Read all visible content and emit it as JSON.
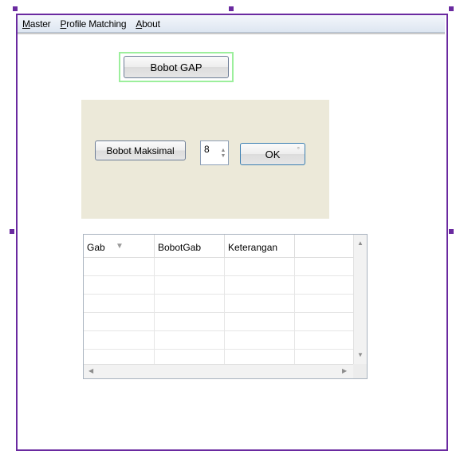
{
  "menu": {
    "items": [
      {
        "mnemonic": "M",
        "rest": "aster"
      },
      {
        "mnemonic": "P",
        "rest": "rofile Matching"
      },
      {
        "mnemonic": "A",
        "rest": "bout"
      }
    ]
  },
  "buttons": {
    "bobot_gap": "Bobot GAP",
    "bobot_maksimal": "Bobot Maksimal",
    "ok": "OK"
  },
  "spinner": {
    "value": "8"
  },
  "grid": {
    "columns": [
      "Gab",
      "BobotGab",
      "Keterangan",
      ""
    ],
    "rows": [
      [
        "",
        "",
        "",
        ""
      ],
      [
        "",
        "",
        "",
        ""
      ],
      [
        "",
        "",
        "",
        ""
      ],
      [
        "",
        "",
        "",
        ""
      ],
      [
        "",
        "",
        "",
        ""
      ],
      [
        "",
        "",
        "",
        ""
      ]
    ]
  },
  "icons": {
    "sort": "sort-down-icon",
    "scroll_up": "scroll-up-icon",
    "scroll_down": "scroll-down-icon",
    "scroll_left": "scroll-left-icon",
    "scroll_right": "scroll-right-icon",
    "spin_up": "spin-up-icon",
    "spin_down": "spin-down-icon"
  },
  "colors": {
    "frame": "#6a2aa0",
    "panel": "#ece9d9",
    "focus_ring": "#9cef9c"
  }
}
